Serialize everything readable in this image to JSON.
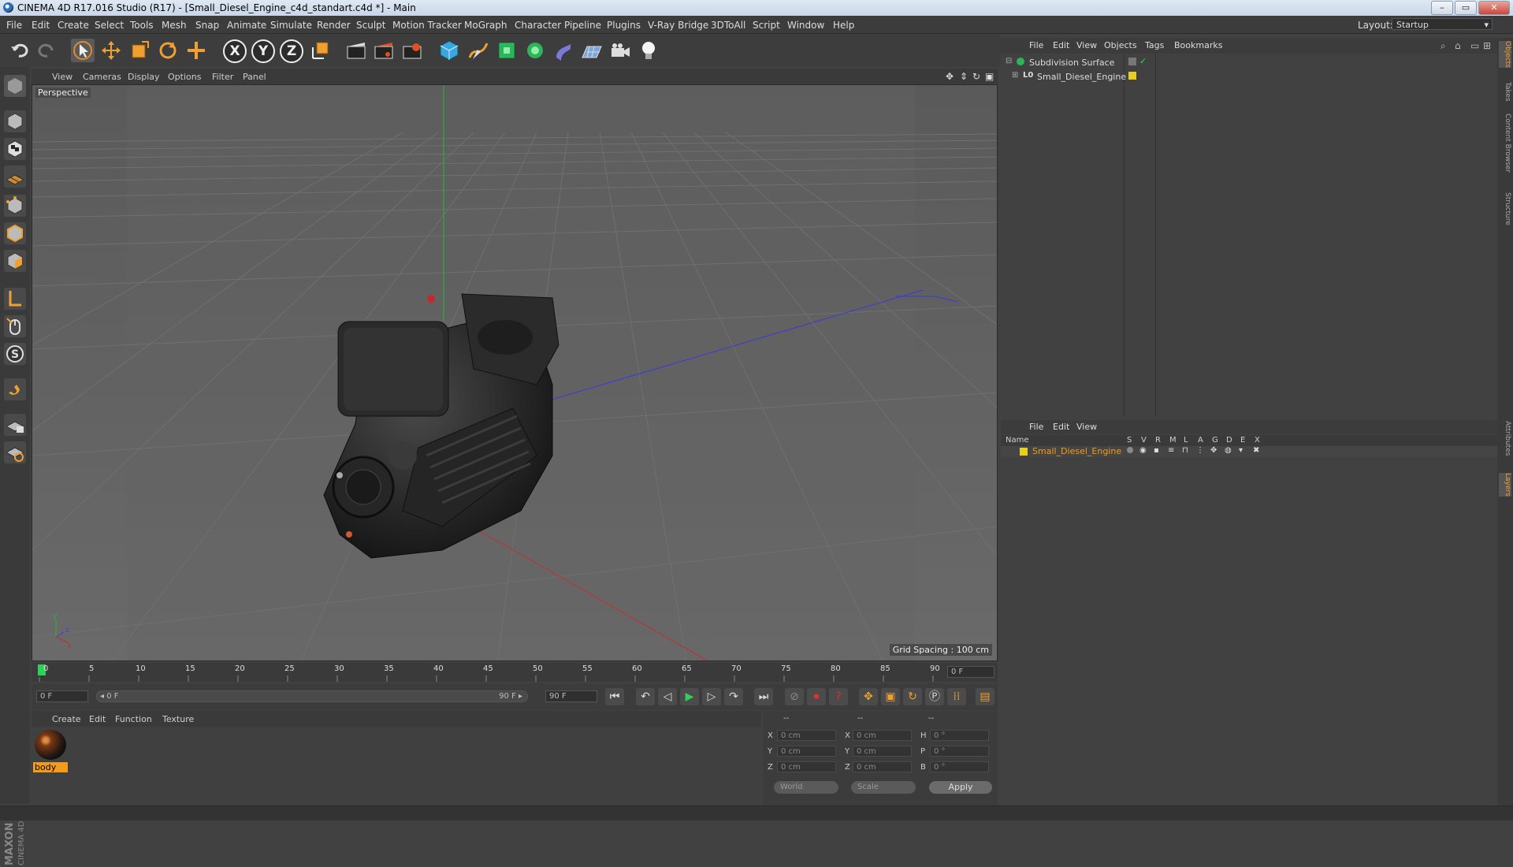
{
  "window": {
    "title": "CINEMA 4D R17.016 Studio (R17) - [Small_Diesel_Engine_c4d_standart.c4d *] - Main",
    "min": "–",
    "max": "▭",
    "close": "✕"
  },
  "menubar": {
    "items": [
      "File",
      "Edit",
      "Create",
      "Select",
      "Tools",
      "Mesh",
      "Snap",
      "Animate",
      "Simulate",
      "Render",
      "Sculpt",
      "Motion Tracker",
      "MoGraph",
      "Character",
      "Pipeline",
      "Plugins",
      "V-Ray Bridge",
      "3DToAll",
      "Script",
      "Window",
      "Help"
    ],
    "layout_label": "Layout:",
    "layout_value": "Startup"
  },
  "toolbar": {
    "axis_x": "X",
    "axis_y": "Y",
    "axis_z": "Z"
  },
  "viewport": {
    "menu": [
      "View",
      "Cameras",
      "Display",
      "Options",
      "Filter",
      "Panel"
    ],
    "camera_label": "Perspective",
    "grid_spacing": "Grid Spacing : 100 cm"
  },
  "timeline": {
    "ticks": [
      "0",
      "5",
      "10",
      "15",
      "20",
      "25",
      "30",
      "35",
      "40",
      "45",
      "50",
      "55",
      "60",
      "65",
      "70",
      "75",
      "80",
      "85",
      "90"
    ],
    "current_frame": "0 F"
  },
  "transport": {
    "start_field": "0 F",
    "range_start": "◂ 0 F",
    "range_end": "90 F ▸",
    "end_field": "90 F"
  },
  "material_manager": {
    "menu": [
      "Create",
      "Edit",
      "Function",
      "Texture"
    ],
    "material_name": "body"
  },
  "coordinates": {
    "header": [
      "--",
      "--",
      "--"
    ],
    "rows": [
      {
        "l1": "X",
        "v1": "0 cm",
        "l2": "X",
        "v2": "0 cm",
        "l3": "H",
        "v3": "0 °"
      },
      {
        "l1": "Y",
        "v1": "0 cm",
        "l2": "Y",
        "v2": "0 cm",
        "l3": "P",
        "v3": "0 °"
      },
      {
        "l1": "Z",
        "v1": "0 cm",
        "l2": "Z",
        "v2": "0 cm",
        "l3": "B",
        "v3": "0 °"
      }
    ],
    "world": "World",
    "scale": "Scale",
    "apply": "Apply"
  },
  "object_manager": {
    "menu": [
      "File",
      "Edit",
      "View",
      "Objects",
      "Tags",
      "Bookmarks"
    ],
    "objects": [
      "Subdivision Surface",
      "Small_Diesel_Engine"
    ]
  },
  "layer_manager": {
    "menu": [
      "File",
      "Edit",
      "View"
    ],
    "columns": [
      "Name",
      "S",
      "V",
      "R",
      "M",
      "L",
      "A",
      "G",
      "D",
      "E",
      "X"
    ],
    "layer_name": "Small_Diesel_Engine"
  },
  "right_tabs": [
    "Objects",
    "Takes",
    "Content Browser",
    "Structure",
    "Attributes",
    "Layers"
  ],
  "brand": {
    "maxon": "MAXON",
    "c4d": "CINEMA 4D"
  },
  "colors": {
    "layer_highlight": "#f39c1a",
    "x_axis": "#c03030",
    "y_axis": "#2fb32f",
    "z_axis": "#3a3adc"
  }
}
